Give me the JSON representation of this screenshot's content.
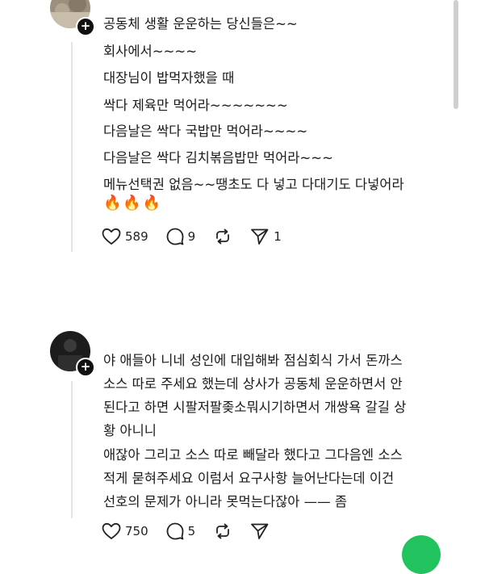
{
  "post1": {
    "lines": [
      "공동체 생활 운운하는 당신들은~~",
      "회사에서~~~~",
      "대장님이 밥먹자했을 때",
      "싹다 제육만 먹어라~~~~~~~",
      "다음날은 싹다 국밥만 먹어라~~~~",
      "다음날은 싹다 김치볶음밥만 먹어라~~~",
      "메뉴선택권 없음~~땡초도 다 넣고 다대기도 다넣어라"
    ],
    "emojis": [
      "🔥",
      "🔥",
      "🔥"
    ],
    "likes": "589",
    "comments": "9",
    "shares": "1"
  },
  "post2": {
    "lines": [
      "야 애들아 니네 성인에 대입해봐 점심회식 가서 돈까스",
      "소스 따로 주세요 했는데 상사가 공동체 운운하면서 안",
      "된다고 하면 시팔저팔좆소뭐시기하면서 개쌍욕 갈길 상",
      "황 아니니",
      "애잖아 그리고 소스 따로 빼달라 했다고 그다음엔 소스",
      "적게 묻혀주세요 이럼서 요구사항 늘어난다는데 이건",
      "선호의 문제가 아니라 못먹는다잖아 —— 좀"
    ],
    "likes": "750",
    "comments": "5"
  },
  "icons": {
    "like": "heart-icon",
    "comment": "comment-bubble-icon",
    "repost": "repost-icon",
    "share": "send-icon",
    "follow": "plus-icon"
  },
  "colors": {
    "text": "#1a1a1a",
    "fab": "#22c35e",
    "scrollbar": "#cfcfcf"
  },
  "follow_symbol": "+"
}
